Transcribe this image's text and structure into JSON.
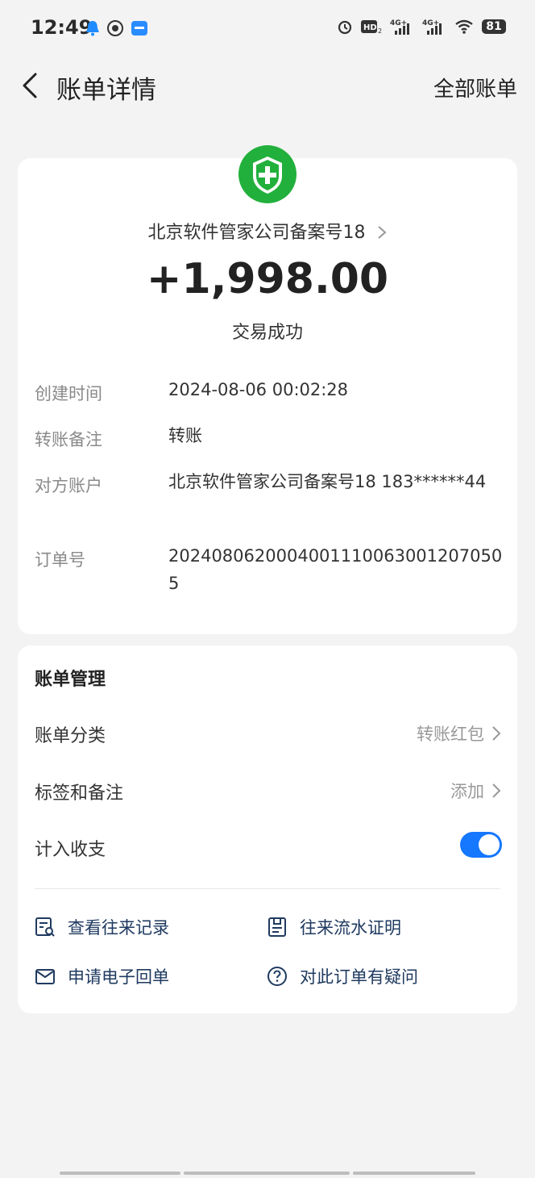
{
  "status_bar": {
    "time": "12:49",
    "battery": "81",
    "icons_left": [
      "notification-bell-icon",
      "app-icon",
      "app-badge-icon"
    ],
    "icons_right": [
      "alarm-icon",
      "hd-icon",
      "signal-4g-icon",
      "signal-4g-icon",
      "wifi-icon",
      "battery-icon"
    ]
  },
  "nav": {
    "title": "账单详情",
    "right_action": "全部账单"
  },
  "transaction": {
    "merchant": "北京软件管家公司备案号18",
    "amount": "+1,998.00",
    "status": "交易成功",
    "icon": "green-shield-plus-icon",
    "brand_color": "#22b03c"
  },
  "details": [
    {
      "label": "创建时间",
      "value": "2024-08-06 00:02:28"
    },
    {
      "label": "转账备注",
      "value": "转账"
    },
    {
      "label": "对方账户",
      "value": "北京软件管家公司备案号18 183******44"
    },
    {
      "label": "订单号",
      "value": "20240806200040011100630012070505"
    }
  ],
  "management": {
    "title": "账单管理",
    "rows": [
      {
        "label": "账单分类",
        "value": "转账红包"
      },
      {
        "label": "标签和备注",
        "value": "添加"
      },
      {
        "label": "计入收支",
        "toggle_on": true
      }
    ],
    "toggle_color": "#1677ff"
  },
  "actions": [
    {
      "label": "查看往来记录",
      "icon": "record-search-icon"
    },
    {
      "label": "往来流水证明",
      "icon": "statement-doc-icon"
    },
    {
      "label": "申请电子回单",
      "icon": "mail-icon"
    },
    {
      "label": "对此订单有疑问",
      "icon": "question-circle-icon"
    }
  ]
}
